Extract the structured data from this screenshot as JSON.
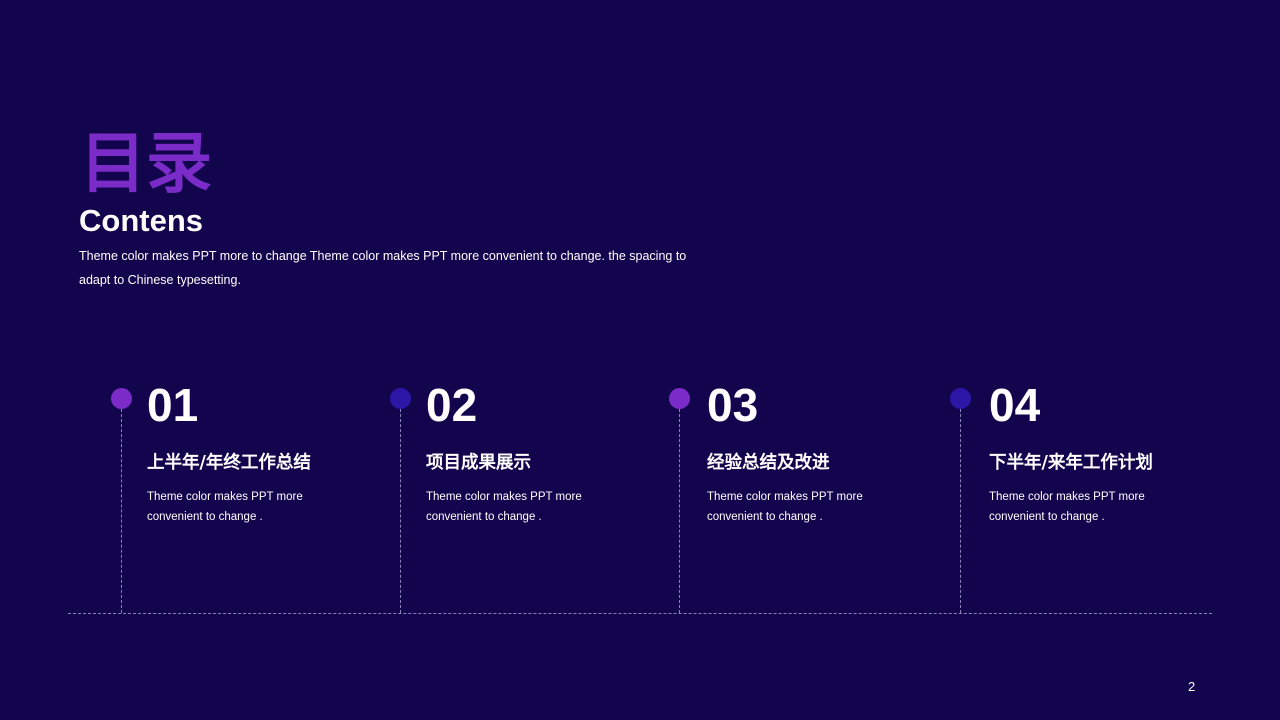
{
  "header": {
    "title_cn": "目录",
    "title_en": "Contens",
    "intro": "Theme  color makes PPT more to change Theme  color makes PPT more convenient  to change. the spacing  to adapt to Chinese  typesetting."
  },
  "items": [
    {
      "number": "01",
      "title": "上半年/年终工作总结",
      "desc_line1": "Theme  color makes PPT more",
      "desc_line2": "convenient to change .",
      "dot_color": "#7b2cc8"
    },
    {
      "number": "02",
      "title": "项目成果展示",
      "desc_line1": "Theme  color makes PPT more",
      "desc_line2": "convenient to change .",
      "dot_color": "#2c16a6"
    },
    {
      "number": "03",
      "title": "经验总结及改进",
      "desc_line1": "Theme  color makes PPT more",
      "desc_line2": "convenient to change .",
      "dot_color": "#7b2cc8"
    },
    {
      "number": "04",
      "title": "下半年/来年工作计划",
      "desc_line1": "Theme  color makes PPT more",
      "desc_line2": "convenient to change .",
      "dot_color": "#2c16a6"
    }
  ],
  "footer": {
    "page_number": "2"
  },
  "colors": {
    "background": "#12054d",
    "accent_purple": "#7b2cc8",
    "accent_blue": "#2c16a6",
    "dashed_line": "#8a82b8"
  }
}
